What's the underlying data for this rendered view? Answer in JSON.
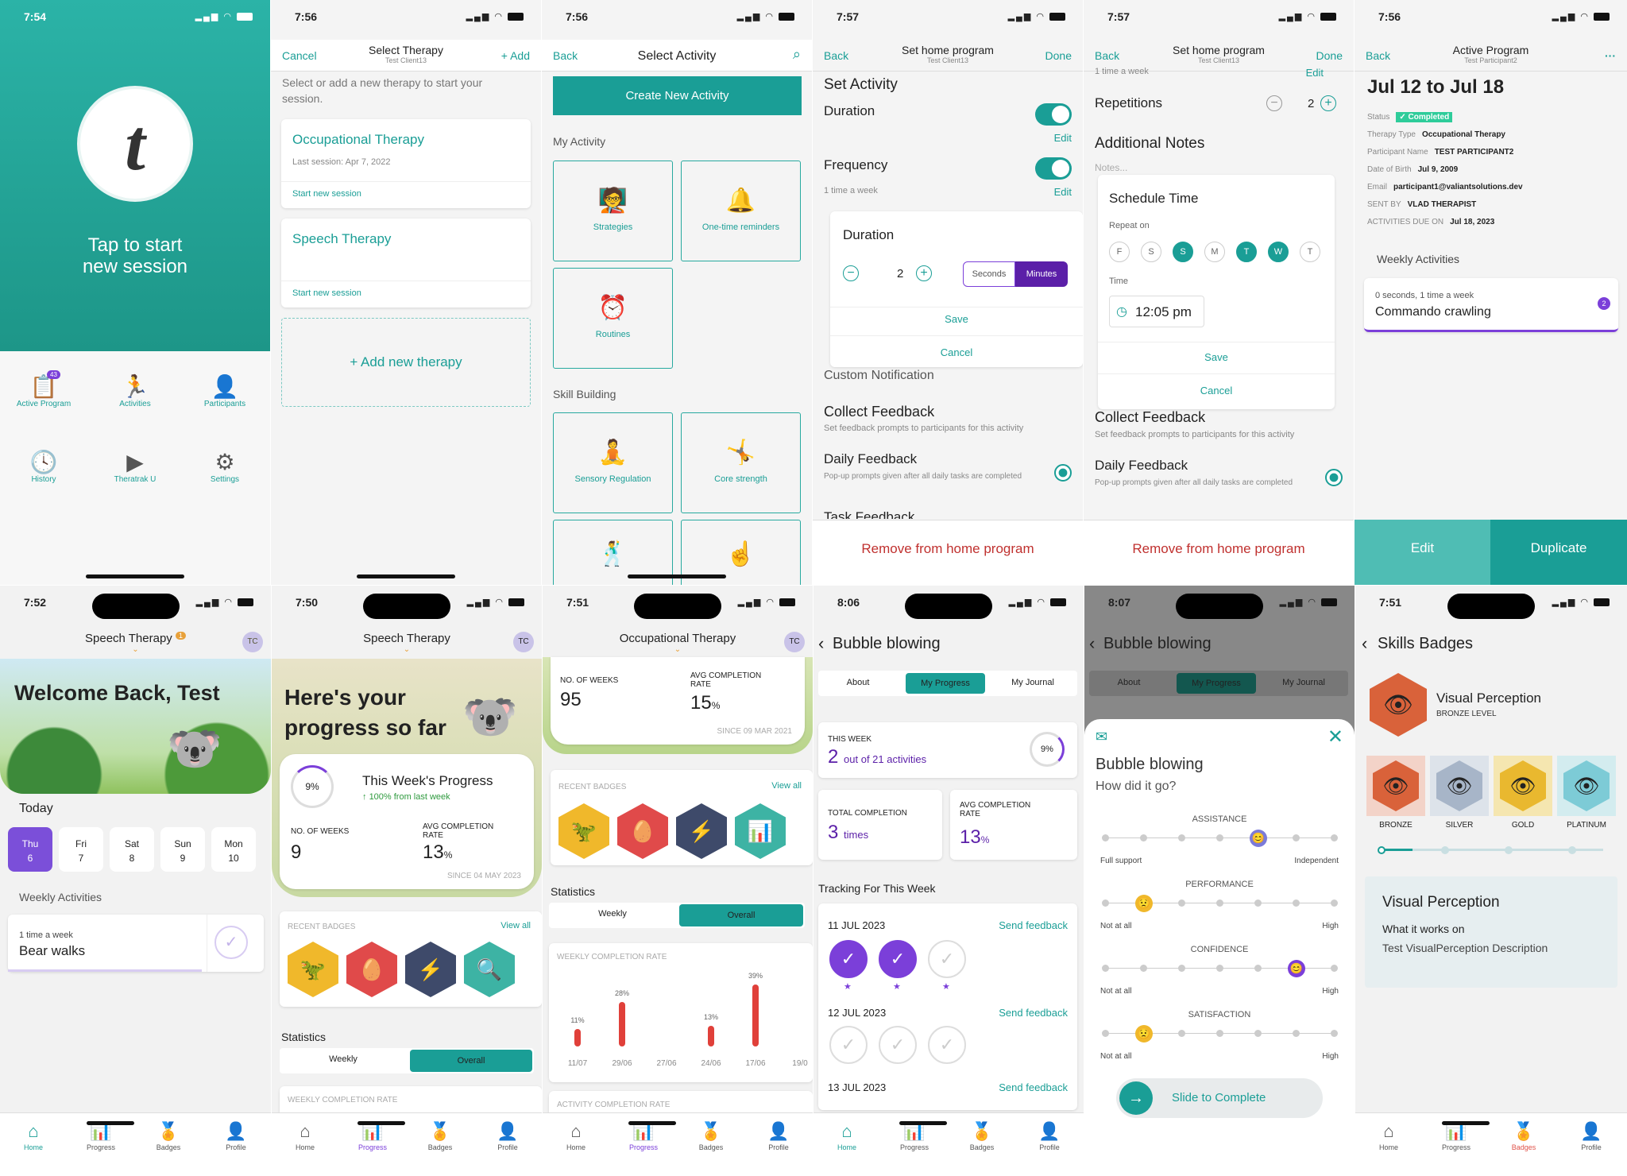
{
  "s1": {
    "time": "7:54",
    "cta": "Tap to start\nnew session",
    "menu": [
      "Active Program",
      "Activities",
      "Participants",
      "History",
      "Theratrak U",
      "Settings"
    ],
    "badge": "43"
  },
  "s2": {
    "time": "7:56",
    "cancel": "Cancel",
    "title": "Select Therapy",
    "sub": "Test Client13",
    "add": "+ Add",
    "intro": "Select or add a new therapy to start your session.",
    "cards": [
      {
        "name": "Occupational Therapy",
        "last": "Last session: Apr 7, 2022",
        "start": "Start new session"
      },
      {
        "name": "Speech Therapy",
        "last": "",
        "start": "Start new session"
      }
    ],
    "addnew": "+ Add new therapy"
  },
  "s3": {
    "time": "7:56",
    "back": "Back",
    "title": "Select Activity",
    "create": "Create New Activity",
    "my": "My Activity",
    "tiles1": [
      "Strategies",
      "One-time reminders",
      "Routines"
    ],
    "skill": "Skill Building",
    "tiles2": [
      "Sensory Regulation",
      "Core strength"
    ]
  },
  "s4": {
    "time": "7:57",
    "back": "Back",
    "title": "Set home program",
    "sub": "Test Client13",
    "done": "Done",
    "set": "Set Activity",
    "duration": "Duration",
    "edit": "Edit",
    "freq": "Frequency",
    "freqval": "1 time a week",
    "modal": {
      "title": "Duration",
      "val": "2",
      "seconds": "Seconds",
      "minutes": "Minutes",
      "save": "Save",
      "cancel": "Cancel"
    },
    "custom": "Custom Notification",
    "collect": "Collect Feedback",
    "collectsub": "Set feedback prompts to participants for this activity",
    "daily": "Daily Feedback",
    "dailysub": "Pop-up prompts given after all daily tasks are completed",
    "task": "Task Feedback",
    "remove": "Remove from home program"
  },
  "s5": {
    "time": "7:57",
    "back": "Back",
    "title": "Set home program",
    "sub": "Test Client13",
    "done": "Done",
    "freqval": "1 time a week",
    "edit": "Edit",
    "reps": "Repetitions",
    "repval": "2",
    "notes": "Additional Notes",
    "notesph": "Notes...",
    "modal": {
      "title": "Schedule Time",
      "repeat": "Repeat on",
      "days": [
        "F",
        "S",
        "S",
        "M",
        "T",
        "W",
        "T"
      ],
      "timel": "Time",
      "time": "12:05 pm",
      "save": "Save",
      "cancel": "Cancel"
    },
    "collect": "Collect Feedback",
    "collectsub": "Set feedback prompts to participants for this activity",
    "daily": "Daily Feedback",
    "dailysub": "Pop-up prompts given after all daily tasks are completed",
    "remove": "Remove from home program"
  },
  "s6": {
    "time": "7:56",
    "back": "Back",
    "title": "Active Program",
    "sub": "Test Participant2",
    "range": "Jul 12 to Jul 18",
    "rows": [
      [
        "Status",
        "Completed"
      ],
      [
        "Therapy Type",
        "Occupational Therapy"
      ],
      [
        "Participant Name",
        "TEST PARTICIPANT2"
      ],
      [
        "Date of Birth",
        "Jul 9, 2009"
      ],
      [
        "Email",
        "participant1@valiantsolutions.dev"
      ],
      [
        "SENT BY",
        "VLAD THERAPIST"
      ],
      [
        "ACTIVITIES DUE ON",
        "Jul 18, 2023"
      ]
    ],
    "weekly": "Weekly Activities",
    "actsub": "0 seconds, 1 time a week",
    "act": "Commando crawling",
    "count": "2",
    "edit": "Edit",
    "dup": "Duplicate"
  },
  "s7": {
    "time": "7:52",
    "therapy": "Speech Therapy",
    "notif": "1",
    "tc": "TC",
    "welcome": "Welcome Back, Test",
    "today": "Today",
    "days": [
      [
        "Thu",
        "6"
      ],
      [
        "Fri",
        "7"
      ],
      [
        "Sat",
        "8"
      ],
      [
        "Sun",
        "9"
      ],
      [
        "Mon",
        "10"
      ]
    ],
    "weekly": "Weekly Activities",
    "actsub": "1 time a week",
    "act": "Bear walks"
  },
  "s8": {
    "time": "7:50",
    "therapy": "Speech Therapy",
    "tc": "TC",
    "hero": "Here's your progress so far",
    "pct": "9%",
    "wp": "This Week's Progress",
    "wpsub": "100% from last week",
    "weeksl": "NO. OF WEEKS",
    "weeks": "9",
    "avgl": "AVG COMPLETION RATE",
    "avg": "13",
    "since": "SINCE 04 MAY 2023",
    "recent": "RECENT BADGES",
    "viewall": "View all",
    "stats": "Statistics",
    "weekly": "Weekly",
    "overall": "Overall",
    "wcr": "WEEKLY COMPLETION RATE"
  },
  "s9": {
    "time": "7:51",
    "therapy": "Occupational Therapy",
    "tc": "TC",
    "weeksl": "NO. OF WEEKS",
    "weeks": "95",
    "avgl": "AVG COMPLETION RATE",
    "avg": "15",
    "since": "SINCE 09 MAR 2021",
    "recent": "RECENT BADGES",
    "viewall": "View all",
    "stats": "Statistics",
    "weekly": "Weekly",
    "overall": "Overall",
    "wcr": "WEEKLY COMPLETION RATE",
    "acr": "ACTIVITY COMPLETION RATE"
  },
  "chart_data": {
    "type": "bar",
    "categories": [
      "11/07",
      "29/06",
      "27/06",
      "24/06",
      "17/06",
      "19/0"
    ],
    "values": [
      11,
      28,
      null,
      13,
      39,
      null
    ],
    "labels": [
      "11%",
      "28%",
      "",
      "13%",
      "39%",
      ""
    ]
  },
  "s10": {
    "time": "8:06",
    "title": "Bubble blowing",
    "tabs": [
      "About",
      "My Progress",
      "My Journal"
    ],
    "thisweek": "THIS WEEK",
    "n": "2",
    "of": "out of 21 activities",
    "pct": "9%",
    "totall": "TOTAL COMPLETION",
    "total": "3",
    "times": "times",
    "avgl": "AVG COMPLETION RATE",
    "avg": "13",
    "tracking": "Tracking For This Week",
    "dates": [
      "11 JUL 2023",
      "12 JUL 2023",
      "13 JUL 2023"
    ],
    "send": "Send feedback"
  },
  "s11": {
    "time": "8:07",
    "title": "Bubble blowing",
    "tabs": [
      "About",
      "My Progress",
      "My Journal"
    ],
    "mtitle": "Bubble blowing",
    "q": "How did it go?",
    "scales": [
      {
        "name": "ASSISTANCE",
        "lo": "Full support",
        "hi": "Independent"
      },
      {
        "name": "PERFORMANCE",
        "lo": "Not at all",
        "hi": "High"
      },
      {
        "name": "CONFIDENCE",
        "lo": "Not at all",
        "hi": "High"
      },
      {
        "name": "SATISFACTION",
        "lo": "Not at all",
        "hi": "High"
      }
    ],
    "slide": "Slide to Complete"
  },
  "s12": {
    "time": "7:51",
    "title": "Skills Badges",
    "badge": "Visual Perception",
    "level": "BRONZE LEVEL",
    "levels": [
      "BRONZE",
      "SILVER",
      "GOLD",
      "PLATINUM"
    ],
    "cardtitle": "Visual Perception",
    "works": "What it works on",
    "desc": "Test VisualPerception Description"
  },
  "tabs": [
    "Home",
    "Progress",
    "Badges",
    "Profile"
  ],
  "colors": {
    "teal": "#1a9e96",
    "purple": "#7b3fd9"
  }
}
